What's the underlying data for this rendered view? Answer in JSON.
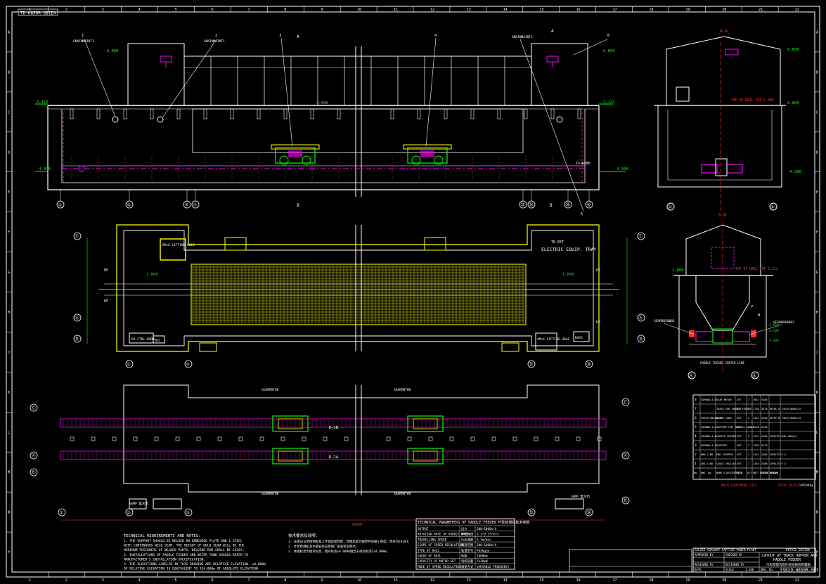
{
  "drawing_no_top": "TD-H850R-SB1E4",
  "border": {
    "columns": [
      "1",
      "2",
      "3",
      "4",
      "5",
      "6",
      "7",
      "8",
      "9",
      "10",
      "11",
      "12",
      "13",
      "14",
      "15",
      "16",
      "17",
      "18",
      "19",
      "20",
      "21",
      "22"
    ],
    "rows": [
      "A",
      "B",
      "C",
      "D",
      "E",
      "F",
      "G",
      "H",
      "J",
      "K",
      "L",
      "M",
      "N",
      "P"
    ]
  },
  "elevation_view": {
    "elev_left": "1.122",
    "elev_right": "1.122",
    "elev_top_left": "6.600",
    "elev_top_right": "6.600",
    "elev_mid": "3.000",
    "elev_bottom_left": "-4.300",
    "elev_bottom_right": "-4.300",
    "pit_dim": "D-4800",
    "axes": [
      "①",
      "②",
      "③",
      "⑦",
      "㉝",
      "㉞",
      "㊳",
      "㊵"
    ],
    "section_marks": [
      "A",
      "A",
      "B",
      "B"
    ],
    "callouts": [
      "1",
      "2",
      "3",
      "4",
      "5",
      "6"
    ],
    "callout_labels": [
      "GMAINMAINT1",
      "GMAINMAINT1",
      "GMAINMAINT1"
    ]
  },
  "section_aa": {
    "title": "A-A",
    "elev_top": "6.600",
    "elev_mid": "0.000",
    "elev_bottom": "-4.300",
    "red_note": "TOP OF RAIL TOP 1.000",
    "axes": [
      "Ⓐ",
      "Ⓑ"
    ]
  },
  "section_bb": {
    "title": "B-B",
    "elev_left": "1.000",
    "red_note": "TOP OF RAIL TOP 1.122",
    "labels": [
      "GEARBOX0001",
      "GEARBOX0002",
      "3-820",
      "4-100",
      "4-300"
    ],
    "callouts": [
      "7",
      "8"
    ],
    "footer": "PADDLE FEEDER CENTER LINE",
    "axes": [
      "Ⓐ",
      "Ⓑ"
    ]
  },
  "plan_view": {
    "elec_tray_code": "TR-EET",
    "elec_tray_label": "ELECTRIC EQUIP. TRAY",
    "lifting_hole_1": "6M×6 LIFTING HOLE",
    "lifting_hole_2": "4M×4 LIFTING HOLE",
    "control_room": "DA CTRL ROOM",
    "mcc": "MCC",
    "rack": "RACK",
    "up_labels": [
      "UP",
      "UP",
      "UP",
      "UP"
    ],
    "level_left": "1.000",
    "level_right": "1.000",
    "axes_rows": [
      "Ⓒ",
      "Ⓐ",
      "Ⓑ"
    ],
    "axes_cols": [
      "①",
      "②",
      "㉝",
      "㉞"
    ]
  },
  "rail_plan": {
    "gearmotor_labels": [
      "GEARMOTOR",
      "GEARMOTOR",
      "GEARMOTOR",
      "GEARMOTOR"
    ],
    "rail_labels": [
      "D-1B",
      "D-1A"
    ],
    "sump_left": "SUMP 集水坑",
    "sump_right": "SUMP 集水坑",
    "axes_cols": [
      "①",
      "②",
      "③",
      "㉝",
      "㉞"
    ],
    "axes_rows": [
      "Ⓒ",
      "Ⓐ",
      "Ⓑ"
    ],
    "overall_dim": "36000"
  },
  "notes": {
    "title": "TECHNICAL REQUIREMENTS AND NOTES:",
    "lines": [
      "1. THE SUPPORT SHOULD BE WELDED ON EMBEDDED PLATE AND I STEEL",
      "   WITH CONTINUOUS WELD SEAM. THE HEIGHT OF WELD SEAM WILL BE THE",
      "   MINIMUM THICKNESS OF WELDED PARTS. WELDING ROD SHALL BE E4303.",
      "2. INSTALLATIONS OF PADDLE FEEDER AND WATER TANK SHOULD REFER TO",
      "   MANUFACTURER'S INSTALLATION SPECIFICATION.",
      "3. THE ELEVATIONS LABELED IN THIS DRAWING ARE RELATIVE ELEVATION. ±0.000m",
      "   OF RELATIVE ELEVATION IS EQUIVALENT TO 334.000m OF ABSOLUTE ELEVATION."
    ]
  },
  "notes_cn": {
    "title": "技术要求及说明：",
    "lines": [
      "1. 支座应与预埋钢板及工字钢连续焊接，焊缝高度为被焊件的最小厚度，焊条为E4303。",
      "2. 叶轮给煤机及水箱安装应参照厂家安装说明书。",
      "3. 本图标高为相对标高，相对标高±0.000m相当于绝对标高334.000m。"
    ]
  },
  "tech_params": {
    "title": "TECHNICAL PARAMETERS OF PADDLE FEEDER 叶轮给煤机技术参数",
    "rows": [
      [
        "OUTPUT",
        "出力",
        "300~1000t/h"
      ],
      [
        "ROTATION RATE OF PADDLE WHEEL",
        "叶轮转速",
        "3.3~9.3r/min"
      ],
      [
        "TRAVELLING SPEED",
        "行走速度",
        "5.7m/min"
      ],
      [
        "SCOPE OF SPEED REGULATION",
        "调速范围",
        "300~1000t/h"
      ],
      [
        "TYPE OF RAIL",
        "轨道型号",
        "P43kg/m"
      ],
      [
        "GAUGE OF RAIL",
        "轨距",
        "1800mm"
      ],
      [
        "CAPACITY OF MOTOR SET",
        "电机容量",
        "2x30kW"
      ],
      [
        "MODE OF SPEED REGULATING",
        "调速方式",
        "VARIABLE FREQUENCY"
      ]
    ]
  },
  "parts_list": {
    "rows": [
      [
        "8",
        "SGMZWD-4.8",
        "GEAR MOTOR",
        "SET",
        "2",
        "1642",
        "3284",
        ""
      ],
      [
        "7",
        "",
        "TRACK FOR PADDLE FEEDER",
        "SET",
        "2",
        "1738",
        "3476",
        "REFER TO FSK29-H850R-02"
      ],
      [
        "6",
        "FSK29-H850R-02",
        "WATER TANK",
        "SET",
        "2",
        "1452",
        "2904",
        "REFER TO FSK29-H850R-03"
      ],
      [
        "5",
        "SGMZWD-4.8",
        "SUPPORT FOR TROLLEY CABLE",
        "SET",
        "2",
        "1228",
        "2456",
        ""
      ],
      [
        "4",
        "SGMZWD-4.8",
        "PADDLE FEEDER",
        "SET",
        "2",
        "1242",
        "2484",
        "CAPACITY=300~1000t/h"
      ],
      [
        "3",
        "SGMZWD-4.8",
        "SUPPORT",
        "SET",
        "2",
        "1238",
        "2476",
        ""
      ],
      [
        "2",
        "HB6-7-BD",
        "END STOPPER",
        "SET",
        "2",
        "1242",
        "2484",
        "CAPACITY=7.5"
      ],
      [
        "1",
        "GB1-4-BD",
        "CABLE TROLLEY",
        "SET",
        "2",
        "1244",
        "2488",
        "CAPACITY=7.5"
      ]
    ],
    "header": [
      "No.",
      "DWG. No.",
      "NAME & DESCRIPTION",
      "UNIT",
      "QTY",
      "UNIT WEIGHT",
      "TOTAL WEIGHT",
      "REMARK"
    ],
    "main_equip_note": "MAIN EQUIPMENT LIST",
    "total_weight_label": "TOTAL WEIGHT",
    "total_weight_value": "49704kg"
  },
  "title_block": {
    "company": "SALOSI COALWAY CAPTIVE POWER PLANT",
    "stage": "DETAIL DESIGN",
    "title_1": "LAYOUT OF TRACK HOPPER AND",
    "title_2": "PADDLE FEEDER",
    "title_cn": "汽车卸煤沟及叶轮给煤机布置图",
    "dwg_label": "DWG. No.",
    "dwg_no": "FSK29-H850R-SB1",
    "scale_label": "SCALE",
    "scale_value": "1:100",
    "approved": "APPROVED BY",
    "checked": "CHECKED BY",
    "reviewed": "REVIEWED BY",
    "designed": "DESIGNED BY",
    "date": "DATE"
  },
  "colors": {
    "background": "#000000",
    "line": "#ffffff",
    "accent_yellow": "#ffff00",
    "accent_red": "#ff3030",
    "accent_green": "#00ff00",
    "accent_magenta": "#ff00ff",
    "accent_cyan": "#00ffff"
  }
}
